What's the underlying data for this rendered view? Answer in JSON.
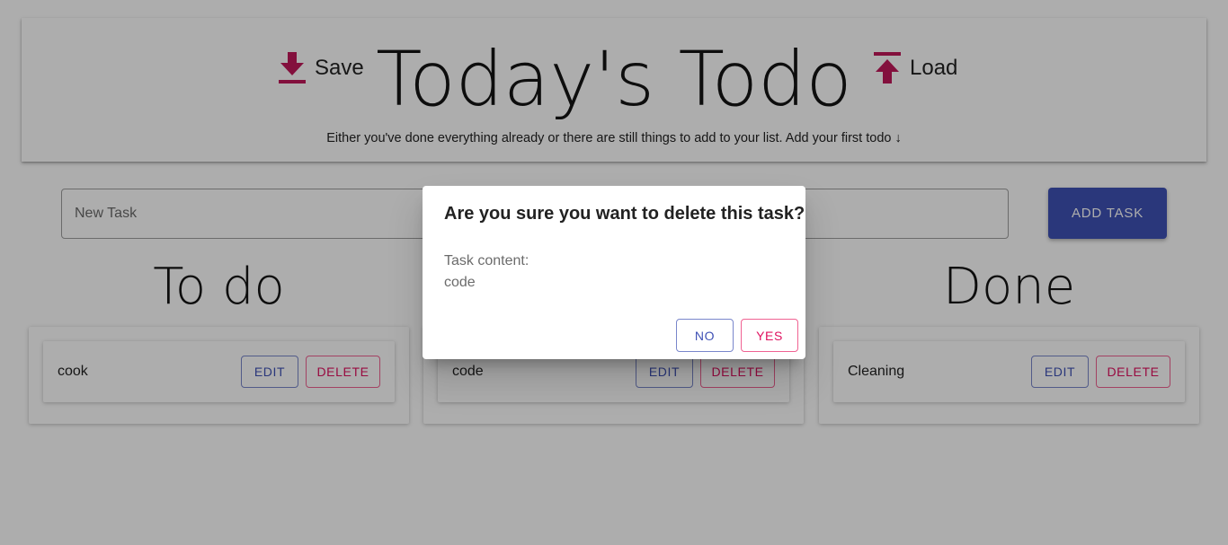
{
  "header": {
    "title": "Today's Todo",
    "save_label": "Save",
    "load_label": "Load",
    "subtitle": "Either you've done everything already or there are still things to add to your list. Add your first todo ↓",
    "icon_color": "#c2185b"
  },
  "input": {
    "placeholder": "New Task",
    "value": ""
  },
  "add_button": "ADD TASK",
  "columns": [
    {
      "title": "To do",
      "cards": [
        {
          "text": "cook",
          "edit": "EDIT",
          "delete": "DELETE"
        }
      ]
    },
    {
      "title": "",
      "cards": [
        {
          "text": "code",
          "edit": "EDIT",
          "delete": "DELETE"
        }
      ]
    },
    {
      "title": "Done",
      "cards": [
        {
          "text": "Cleaning",
          "edit": "EDIT",
          "delete": "DELETE"
        }
      ]
    }
  ],
  "dialog": {
    "title": "Are you sure you want to delete this task?",
    "content_label": "Task content:",
    "content_value": "code",
    "no_label": "NO",
    "yes_label": "YES"
  },
  "colors": {
    "primary": "#3f51b5",
    "accent": "#e0115f"
  }
}
